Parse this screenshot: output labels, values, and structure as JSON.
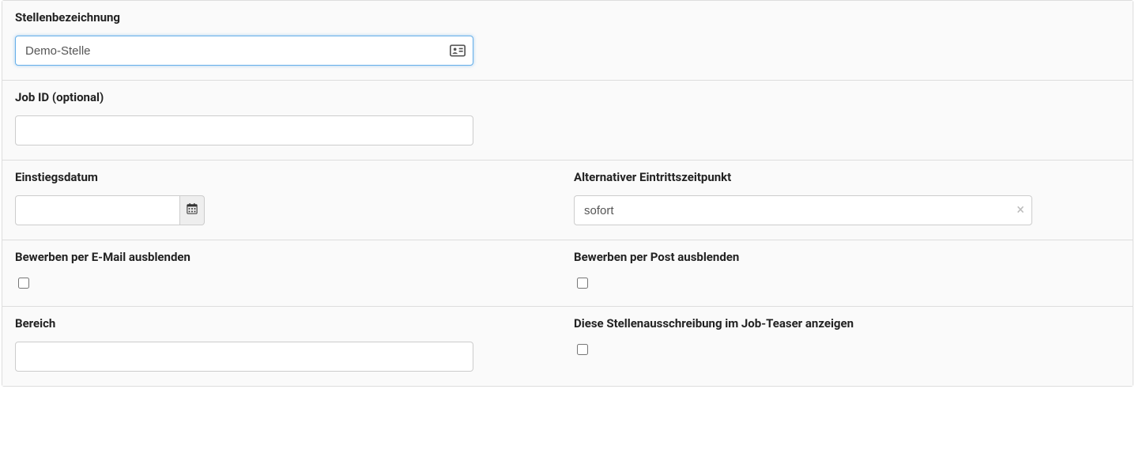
{
  "jobTitle": {
    "label": "Stellenbezeichnung",
    "value": "Demo-Stelle"
  },
  "jobId": {
    "label": "Job ID (optional)",
    "value": ""
  },
  "startDate": {
    "label": "Einstiegsdatum",
    "value": ""
  },
  "altStart": {
    "label": "Alternativer Eintrittszeitpunkt",
    "value": "sofort"
  },
  "hideEmail": {
    "label": "Bewerben per E-Mail ausblenden",
    "checked": false
  },
  "hidePost": {
    "label": "Bewerben per Post ausblenden",
    "checked": false
  },
  "area": {
    "label": "Bereich",
    "value": ""
  },
  "showTeaser": {
    "label": "Diese Stellenausschreibung im Job-Teaser anzeigen",
    "checked": false
  }
}
